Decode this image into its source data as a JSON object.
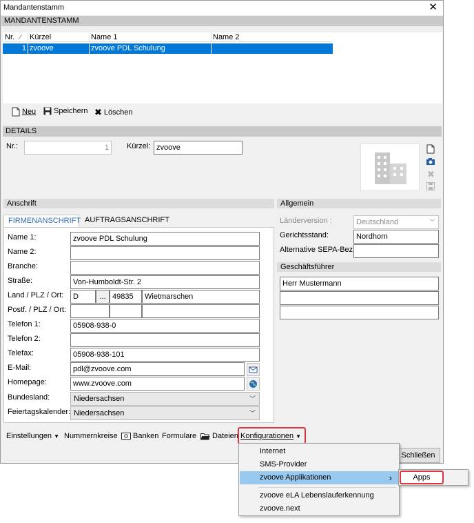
{
  "window": {
    "title": "Mandantenstamm",
    "close_glyph": "✕"
  },
  "mandantenstamm": {
    "section_title": "MANDANTENSTAMM",
    "columns": {
      "nr": "Nr.",
      "sort": "⁄",
      "kuerzel": "Kürzel",
      "name1": "Name 1",
      "name2": "Name 2"
    },
    "rows": [
      {
        "nr": "1",
        "kuerzel": "zvoove",
        "name1": "zvoove PDL Schulung",
        "name2": ""
      }
    ]
  },
  "toolbar": {
    "new_label": "Neu",
    "save_label": "Speichern",
    "delete_label": "Löschen"
  },
  "details": {
    "section_title": "DETAILS",
    "nr_label": "Nr.:",
    "nr_value": "1",
    "kuerzel_label": "Kürzel:",
    "kuerzel_value": "zvoove"
  },
  "anschrift": {
    "title": "Anschrift",
    "tabs": [
      "FIRMENANSCHRIFT",
      "AUFTRAGSANSCHRIFT"
    ],
    "labels": {
      "name1": "Name 1:",
      "name2": "Name 2:",
      "branche": "Branche:",
      "strasse": "Straße:",
      "land": "Land / PLZ / Ort:",
      "postf": "Postf. / PLZ / Ort:",
      "tel1": "Telefon 1:",
      "tel2": "Telefon 2:",
      "fax": "Telefax:",
      "email": "E-Mail:",
      "homepage": "Homepage:",
      "bundesland": "Bundesland:",
      "feiertag": "Feiertagskalender:"
    },
    "values": {
      "name1": "zvoove PDL Schulung",
      "name2": "",
      "branche": "",
      "strasse": "Von-Humboldt-Str. 2",
      "land": "D",
      "land_button": "...",
      "plz": "49835",
      "ort": "Wietmarschen",
      "postf": "",
      "postf_plz": "",
      "postf_ort": "",
      "tel1": "05908-938-0",
      "tel2": "",
      "fax": "05908-938-101",
      "email": "pdl@zvoove.com",
      "homepage": "www.zvoove.com",
      "bundesland": "Niedersachsen",
      "feiertag": "Niedersachsen"
    }
  },
  "allgemein": {
    "title": "Allgemein",
    "laenderversion_label": "Länderversion :",
    "laenderversion_value": "Deutschland",
    "gerichtsstand_label": "Gerichtsstand:",
    "gerichtsstand_value": "Nordhorn",
    "sepa_label": "Alternative SEPA-Bez.:",
    "sepa_value": ""
  },
  "geschaeftsfuehrer": {
    "title": "Geschäftsführer",
    "values": [
      "Herr Mustermann",
      "",
      ""
    ]
  },
  "bottom_bar": {
    "einstellungen": "Einstellungen",
    "nummernkreise": "Nummernkreise",
    "banken": "Banken",
    "formulare": "Formulare",
    "dateien": "Dateien",
    "konfigurationen": "Konfigurationen",
    "schliessen": "Schließen"
  },
  "menu": {
    "items": [
      "Internet",
      "SMS-Provider",
      "zvoove Applikationen",
      "zvoove eLA Lebenslauferkennung",
      "zvoove.next"
    ],
    "submenu_arrow": "›",
    "submenu": [
      "Apps"
    ]
  },
  "colors": {
    "selection": "#0078d7",
    "menu_highlight": "#99c9ef",
    "highlight_border": "#d9363e",
    "link_blue": "#2f6db5"
  }
}
